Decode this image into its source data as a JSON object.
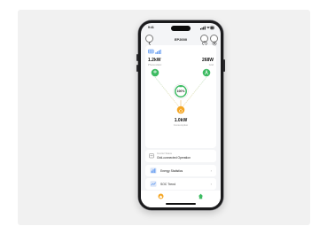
{
  "status_bar": {
    "time": "9:41"
  },
  "header": {
    "title": "EP2000"
  },
  "energy_flow": {
    "photovoltaic": {
      "value": "1.2kW",
      "label": "Photovoltaic"
    },
    "grid": {
      "value": "268W",
      "label": "Grid"
    },
    "battery": {
      "soc": "100%"
    },
    "consumption": {
      "value": "1.0kW",
      "label": "Consumption"
    }
  },
  "inverter_status": {
    "label": "Inverter Status",
    "value": "Grid-connected Operation"
  },
  "menu": [
    {
      "label": "Energy Statistics"
    },
    {
      "label": "SOC Trend"
    }
  ],
  "colors": {
    "accent_green": "#3dbb62",
    "accent_orange": "#f5a623",
    "solar_blue": "#4a8cf0"
  }
}
